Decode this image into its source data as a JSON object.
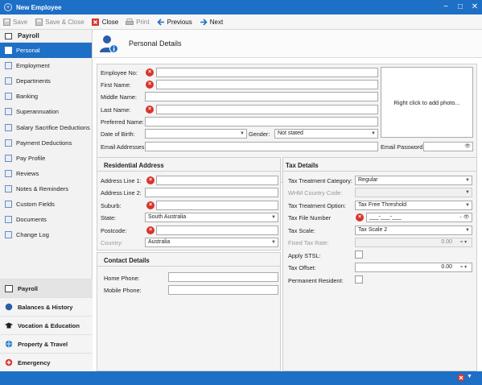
{
  "window": {
    "title": "New Employee",
    "minimize": "−",
    "maximize": "□",
    "close": "✕"
  },
  "toolbar": {
    "save": "Save",
    "save_close": "Save & Close",
    "close": "Close",
    "print": "Print",
    "previous": "Previous",
    "next": "Next"
  },
  "sidebar": {
    "header": "Payroll",
    "items": [
      {
        "label": "Personal"
      },
      {
        "label": "Employment"
      },
      {
        "label": "Departments"
      },
      {
        "label": "Banking"
      },
      {
        "label": "Superannuation"
      },
      {
        "label": "Salary Sacrifice Deductions"
      },
      {
        "label": "Payment Deductions"
      },
      {
        "label": "Pay Profile"
      },
      {
        "label": "Reviews"
      },
      {
        "label": "Notes & Reminders"
      },
      {
        "label": "Custom Fields"
      },
      {
        "label": "Documents"
      },
      {
        "label": "Change Log"
      }
    ],
    "groups": [
      {
        "label": "Payroll"
      },
      {
        "label": "Balances & History"
      },
      {
        "label": "Vocation & Education"
      },
      {
        "label": "Property & Travel"
      },
      {
        "label": "Emergency"
      }
    ]
  },
  "page": {
    "title": "Personal Details"
  },
  "personal": {
    "employee_no": "Employee No:",
    "first_name": "First Name:",
    "middle_name": "Middle Name:",
    "last_name": "Last Name:",
    "preferred_name": "Preferred Name:",
    "dob": "Date of Birth:",
    "gender": "Gender:",
    "gender_value": "Not stated",
    "email_addresses": "Email Addresses:",
    "email_password": "Email Password:",
    "photo_hint": "Right click to add photo..."
  },
  "residential": {
    "title": "Residential Address",
    "line1": "Address Line 1:",
    "line2": "Address Line 2:",
    "suburb": "Suburb:",
    "state": "State:",
    "state_value": "South Australia",
    "postcode": "Postcode:",
    "country": "Country:",
    "country_value": "Australia"
  },
  "contact": {
    "title": "Contact Details",
    "home_phone": "Home Phone:",
    "mobile_phone": "Mobile Phone:"
  },
  "tax": {
    "title": "Tax Details",
    "category": "Tax Treatment Category:",
    "category_value": "Regular",
    "whm_country": "WHM Country Code:",
    "treatment_option": "Tax Treatment Option:",
    "treatment_option_value": "Tax Free Threshold",
    "tfn": "Tax File Number",
    "tfn_value": "___-___-___",
    "scale": "Tax Scale:",
    "scale_value": "Tax Scale 2",
    "fixed_rate": "Fixed Tax Rate:",
    "fixed_rate_value": "0.00",
    "apply_stsl": "Apply STSL:",
    "tax_offset": "Tax Offset:",
    "tax_offset_value": "0.00",
    "permanent_resident": "Permanent Resident:"
  },
  "colors": {
    "accent": "#1e6fc6",
    "error": "#d9342b"
  }
}
